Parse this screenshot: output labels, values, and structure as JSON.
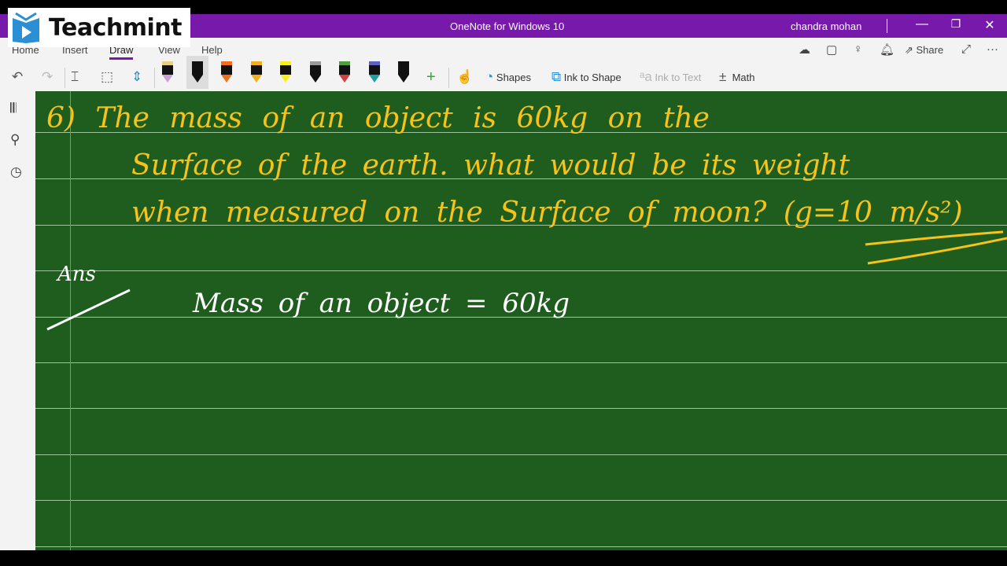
{
  "watermark": {
    "brand": "Teachmint"
  },
  "titlebar": {
    "app_title": "OneNote for Windows 10",
    "user": "chandra mohan",
    "minimize": "—",
    "restore": "❐",
    "close": "✕"
  },
  "ribbon": {
    "tabs": [
      {
        "label": "Home"
      },
      {
        "label": "Insert"
      },
      {
        "label": "Draw",
        "active": true
      },
      {
        "label": "View"
      },
      {
        "label": "Help"
      }
    ],
    "right": {
      "share": "Share",
      "more": "···"
    },
    "tools": {
      "shapes": "Shapes",
      "ink_to_shape": "Ink to Shape",
      "ink_to_text": "Ink to Text",
      "math": "Math"
    },
    "pens": [
      {
        "cap": "#e8d080",
        "tip": "#c9a0d8"
      },
      {
        "cap": "#111",
        "tip": "#111"
      },
      {
        "cap": "#f07020",
        "tip": "#f07020"
      },
      {
        "cap": "#f0b020",
        "tip": "#f0b020"
      },
      {
        "cap": "#f7f020",
        "tip": "#f7f020"
      },
      {
        "cap": "#999",
        "tip": "#111"
      },
      {
        "cap": "#50a040",
        "tip": "#d04040"
      },
      {
        "cap": "#6060c0",
        "tip": "#20a0a0"
      },
      {
        "cap": "#111",
        "tip": "#111"
      }
    ]
  },
  "canvas": {
    "background": "#1f5d1f",
    "question": [
      "6) The  mass of  an object  is 60kg on the",
      "Surface of the earth. what would be its weight",
      "when  measured  on the Surface of moon? (g=10 m/s²)"
    ],
    "answer_label": "Ans",
    "answer_line1": "Mass of an object  = 60kg"
  }
}
